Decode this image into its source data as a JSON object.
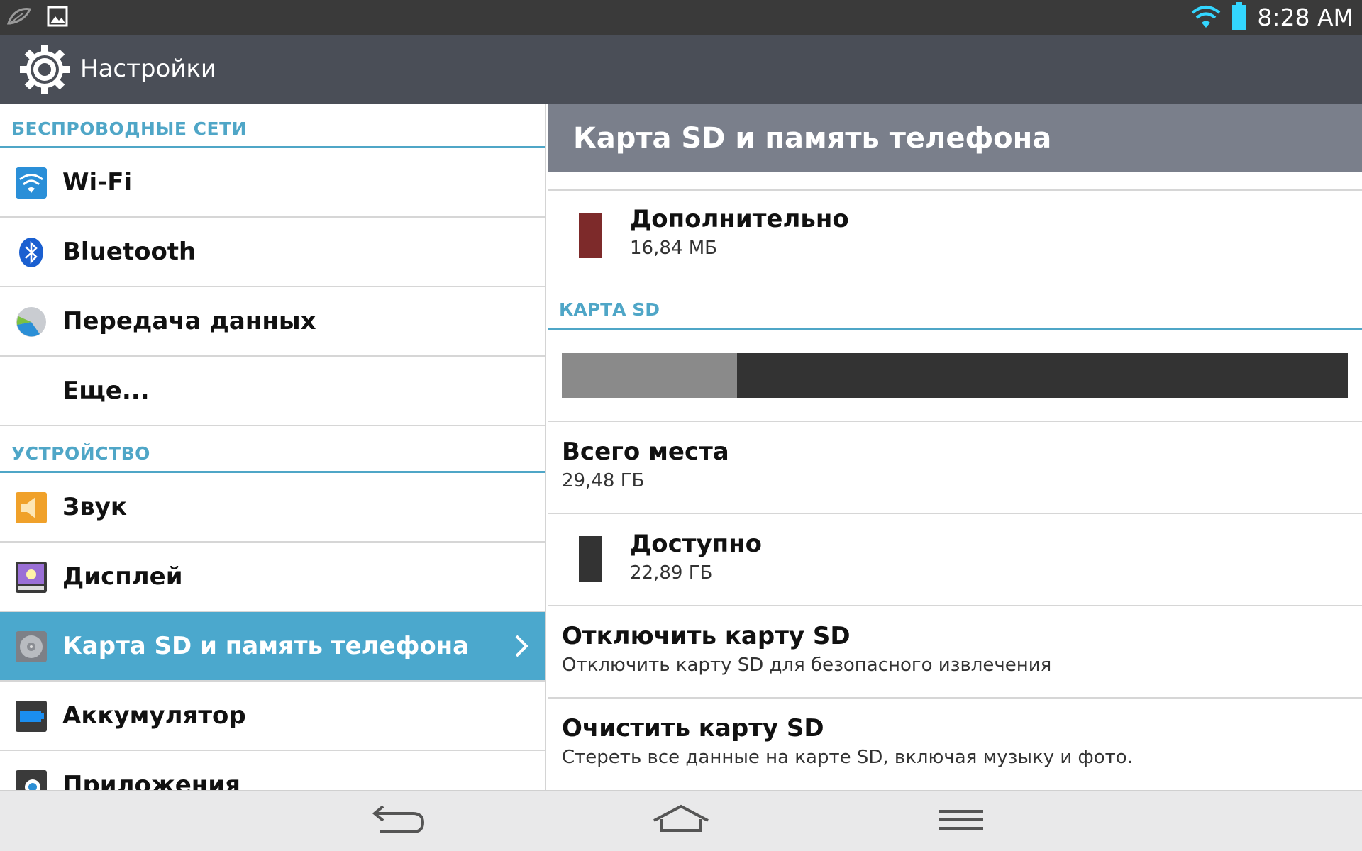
{
  "status_bar": {
    "time": "8:28 AM",
    "notification_icons": [
      "leaf-icon",
      "image-icon"
    ],
    "wifi_color": "#33d6ff",
    "battery_color": "#33d6ff"
  },
  "action_bar": {
    "title": "Настройки"
  },
  "left_pane": {
    "sections": [
      {
        "header": "БЕСПРОВОДНЫЕ СЕТИ",
        "items": [
          {
            "label": "Wi-Fi",
            "icon": "wifi-icon"
          },
          {
            "label": "Bluetooth",
            "icon": "bluetooth-icon"
          },
          {
            "label": "Передача данных",
            "icon": "data-usage-icon"
          },
          {
            "label": "Еще...",
            "icon": ""
          }
        ]
      },
      {
        "header": "УСТРОЙСТВО",
        "items": [
          {
            "label": "Звук",
            "icon": "sound-icon"
          },
          {
            "label": "Дисплей",
            "icon": "display-icon"
          },
          {
            "label": "Карта SD и память телефона",
            "icon": "storage-icon",
            "selected": true
          },
          {
            "label": "Аккумулятор",
            "icon": "battery-icon"
          },
          {
            "label": "Приложения",
            "icon": "apps-icon"
          }
        ]
      }
    ],
    "accent_color": "#4fa6c7",
    "selected_color": "#4ba8cd"
  },
  "detail": {
    "title": "Карта SD и память телефона",
    "misc": {
      "label": "Дополнительно",
      "value": "16,84 МБ",
      "swatch_color": "#7d2a2a"
    },
    "sd_header": "КАРТА SD",
    "usage_used_fraction": 0.223,
    "total": {
      "label": "Всего места",
      "value": "29,48 ГБ"
    },
    "available": {
      "label": "Доступно",
      "value": "22,89 ГБ",
      "swatch_color": "#333333"
    },
    "unmount": {
      "label": "Отключить карту SD",
      "desc": "Отключить карту SD для безопасного извлечения"
    },
    "erase": {
      "label": "Очистить карту SD",
      "desc": "Стереть все данные на карте SD, включая музыку и фото."
    }
  },
  "nav_bar": {
    "buttons": [
      "back-icon",
      "home-icon",
      "menu-icon"
    ]
  }
}
